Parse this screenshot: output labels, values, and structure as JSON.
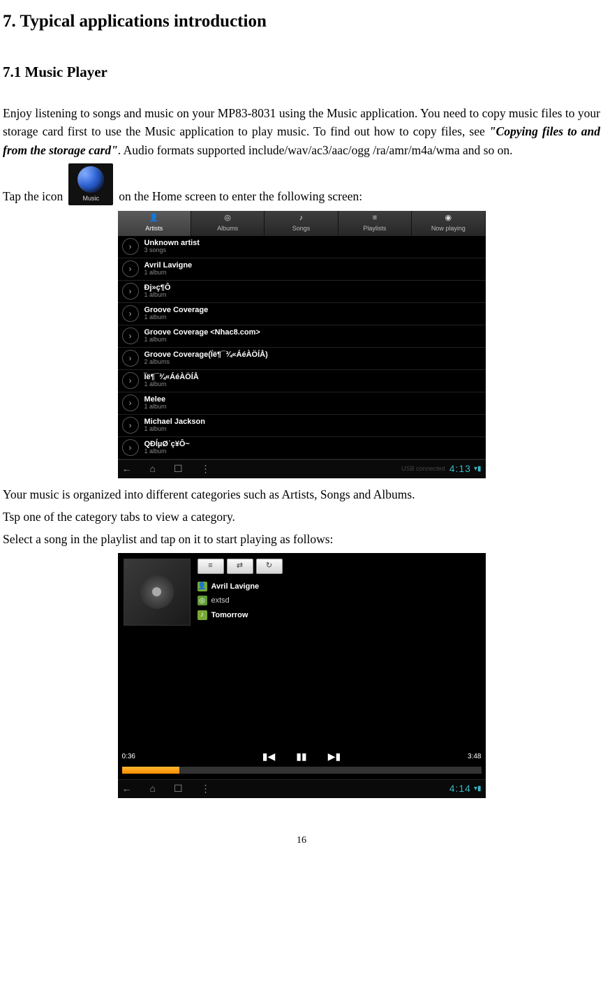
{
  "heading1": "7. Typical applications introduction",
  "heading2": "7.1 Music Player",
  "para1_a": "Enjoy listening to songs and music on your MP83-8031 using the Music application. You need to copy music files to your storage card first to use the Music application to play music. To find out how to copy files, see ",
  "para1_b": "\"Copying files to and from the storage card\"",
  "para1_c": ". Audio formats supported include/wav/ac3/aac/ogg /ra/amr/m4a/wma and so on.",
  "tapline_a": "Tap the icon",
  "tapline_b": " on the Home screen to enter the following screen:",
  "music_icon_label": "Music",
  "ss1": {
    "tabs": [
      {
        "label": "Artists",
        "icon": "👤",
        "active": true
      },
      {
        "label": "Albums",
        "icon": "◎",
        "active": false
      },
      {
        "label": "Songs",
        "icon": "♪",
        "active": false
      },
      {
        "label": "Playlists",
        "icon": "≡",
        "active": false
      },
      {
        "label": "Now playing",
        "icon": "◉",
        "active": false
      }
    ],
    "artists": [
      {
        "name": "Unknown artist",
        "sub": "3 songs"
      },
      {
        "name": "Avril Lavigne",
        "sub": "1 album"
      },
      {
        "name": "Đj»ç¶Ô",
        "sub": "1 album"
      },
      {
        "name": "Groove Coverage",
        "sub": "1 album"
      },
      {
        "name": "Groove Coverage <Nhac8.com>",
        "sub": "1 album"
      },
      {
        "name": "Groove Coverage(Ïë¶¯¾«ÁéÀÖÍÅ)",
        "sub": "2 albums"
      },
      {
        "name": "Ïë¶¯¾«ÁéÀÖÍÅ",
        "sub": "1 album"
      },
      {
        "name": "Melee",
        "sub": "1 album"
      },
      {
        "name": "Michael Jackson",
        "sub": "1 album"
      },
      {
        "name": "QĐĺµØ˙ç¥Ô~",
        "sub": "1 album"
      }
    ],
    "usb_text": "USB connected",
    "clock": "4:13"
  },
  "para2_a": "Your music is organized into different categories such as Artists, Songs and Albums.",
  "para2_b": "Tsp one of the category tabs to view a category.",
  "para2_c": "Select a song in the playlist and tap on it to start playing as follows:",
  "ss2": {
    "artist": "Avril Lavigne",
    "album": "extsd",
    "song": "Tomorrow",
    "time_current": "0:36",
    "time_total": "3:48",
    "clock": "4:14"
  },
  "page_number": "16"
}
